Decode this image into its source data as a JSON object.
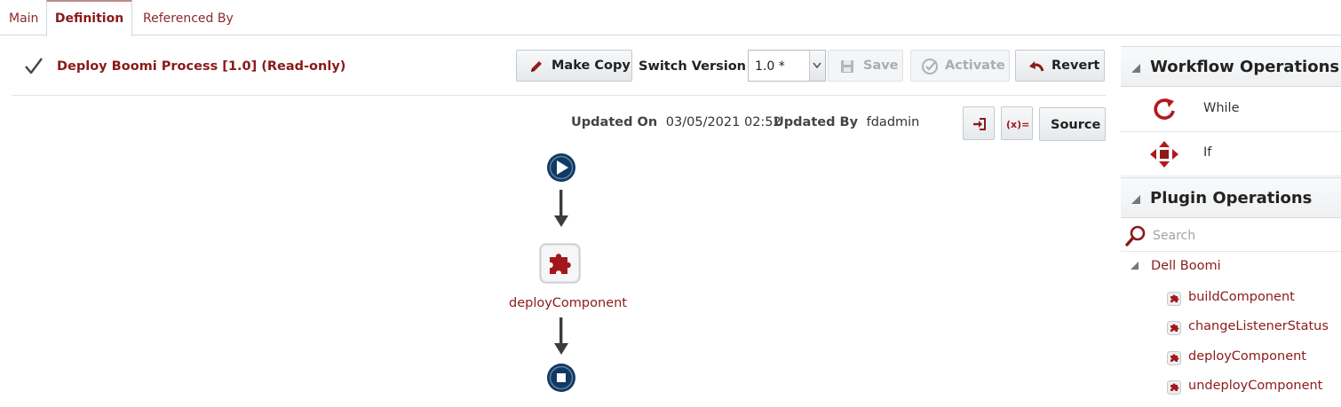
{
  "tabs": [
    "Main",
    "Definition",
    "Referenced By"
  ],
  "process": {
    "title": "Deploy Boomi Process [1.0] (Read-only)"
  },
  "toolbar": {
    "make_copy": "Make Copy",
    "switch_version": "Switch Version",
    "version_value": "1.0 *",
    "save": "Save",
    "activate": "Activate",
    "revert": "Revert",
    "source": "Source"
  },
  "meta": {
    "updated_on_label": "Updated On",
    "updated_on": "03/05/2021 02:52",
    "updated_by_label": "Updated By",
    "updated_by": "fdadmin"
  },
  "flow": {
    "node_label": "deployComponent"
  },
  "workflow_ops": {
    "title": "Workflow Operations",
    "items": [
      "While",
      "If"
    ]
  },
  "plugin_ops": {
    "title": "Plugin Operations",
    "search_placeholder": "Search",
    "group": "Dell Boomi",
    "items": [
      "buildComponent",
      "changeListenerStatus",
      "deployComponent",
      "undeployComponent"
    ]
  },
  "colors": {
    "brand": "#8b1a1a",
    "node_blue": "#0f3a66"
  }
}
